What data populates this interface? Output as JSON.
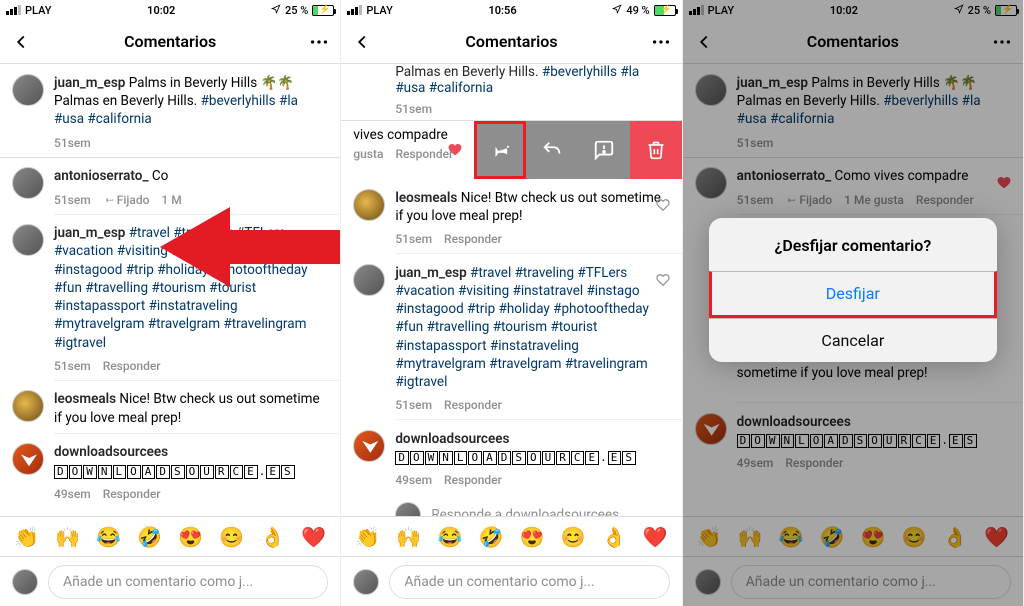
{
  "emojis": [
    "👏",
    "🙌",
    "😂",
    "🤣",
    "😍",
    "😊",
    "👌",
    "❤️"
  ],
  "panel1": {
    "status": {
      "carrier": "PLAY",
      "time": "10:02",
      "battery_text": "25 %",
      "battery_fill": 25
    },
    "nav_title": "Comentarios",
    "caption": {
      "user": "juan_m_esp",
      "text_plain_a": " Palms in Beverly Hills 🌴🌴 Palmas en Beverly Hills. ",
      "tags": "#beverlyhills #la #usa #california",
      "age": "51sem"
    },
    "pinned": {
      "user": "antonioserrato_",
      "text": " Co",
      "age": "51sem",
      "pinned_label": "Fijado",
      "likes_label": "1 M"
    },
    "c_travel": {
      "user": "juan_m_esp",
      "tags": "#travel #traveling #TFLers #vacation #visiting #instatravel #instago #instagood #trip #holiday #photooftheday #fun #travelling #tourism #tourist #instapassport #instatraveling #mytravelgram #travelgram #travelingram #igtravel",
      "age": "51sem",
      "reply": "Responder"
    },
    "c_leo": {
      "user": "leosmeals",
      "text": " Nice! Btw check us out sometime if you love meal prep!"
    },
    "c_dl": {
      "user": "downloadsourcees",
      "blocky": "DOWNLOADSOURCE.ES",
      "age": "49sem",
      "reply": "Responder"
    },
    "input_placeholder": "Añade un comentario como j..."
  },
  "panel2": {
    "status": {
      "carrier": "PLAY",
      "time": "10:56",
      "battery_text": "49 %",
      "battery_fill": 49
    },
    "nav_title": "Comentarios",
    "partial_top": "Palmas en Beverly Hills. ",
    "partial_tags": "#beverlyhills #la #usa #california",
    "partial_age": "51sem",
    "swipe": {
      "visible_text": "vives compadre",
      "like_label": "gusta",
      "reply": "Responder"
    },
    "c_leo": {
      "user": "leosmeals",
      "text": " Nice! Btw check us out sometime if you love meal prep!",
      "age": "51sem",
      "reply": "Responder"
    },
    "c_travel": {
      "user": "juan_m_esp",
      "tags": "#travel #traveling #TFLers #vacation #visiting #instatravel #instago #instagood #trip #holiday #photooftheday #fun #travelling #tourism #tourist #instapassport #instatraveling #mytravelgram #travelgram #travelingram #igtravel",
      "age": "51sem",
      "reply": "Responder"
    },
    "c_dl": {
      "user": "downloadsourcees",
      "blocky": "DOWNLOADSOURCE.ES",
      "age": "49sem",
      "reply": "Responder"
    },
    "reply_hint": "Responde a downloadsourcees...",
    "input_placeholder": "Añade un comentario como j..."
  },
  "panel3": {
    "status": {
      "carrier": "PLAY",
      "time": "10:02",
      "battery_text": "25 %",
      "battery_fill": 25
    },
    "nav_title": "Comentarios",
    "caption": {
      "user": "juan_m_esp",
      "text_plain_a": " Palms in Beverly Hills 🌴🌴 Palmas en Beverly Hills. ",
      "tags": "#beverlyhills #la #usa #california",
      "age": "51sem"
    },
    "pinned": {
      "user": "antonioserrato_",
      "text": " Como vives compadre",
      "age": "51sem",
      "pinned_label": "Fijado",
      "likes_label": "1 Me gusta",
      "reply": "Responder"
    },
    "alert": {
      "title": "¿Desfijar comentario?",
      "primary": "Desfijar",
      "cancel": "Cancelar"
    },
    "c_leo_cut": "sometime if you love meal prep!",
    "c_dl": {
      "user": "downloadsourcees",
      "blocky": "DOWNLOADSOURCE.ES",
      "age": "49sem",
      "reply": "Responder"
    },
    "input_placeholder": "Añade un comentario como j..."
  }
}
